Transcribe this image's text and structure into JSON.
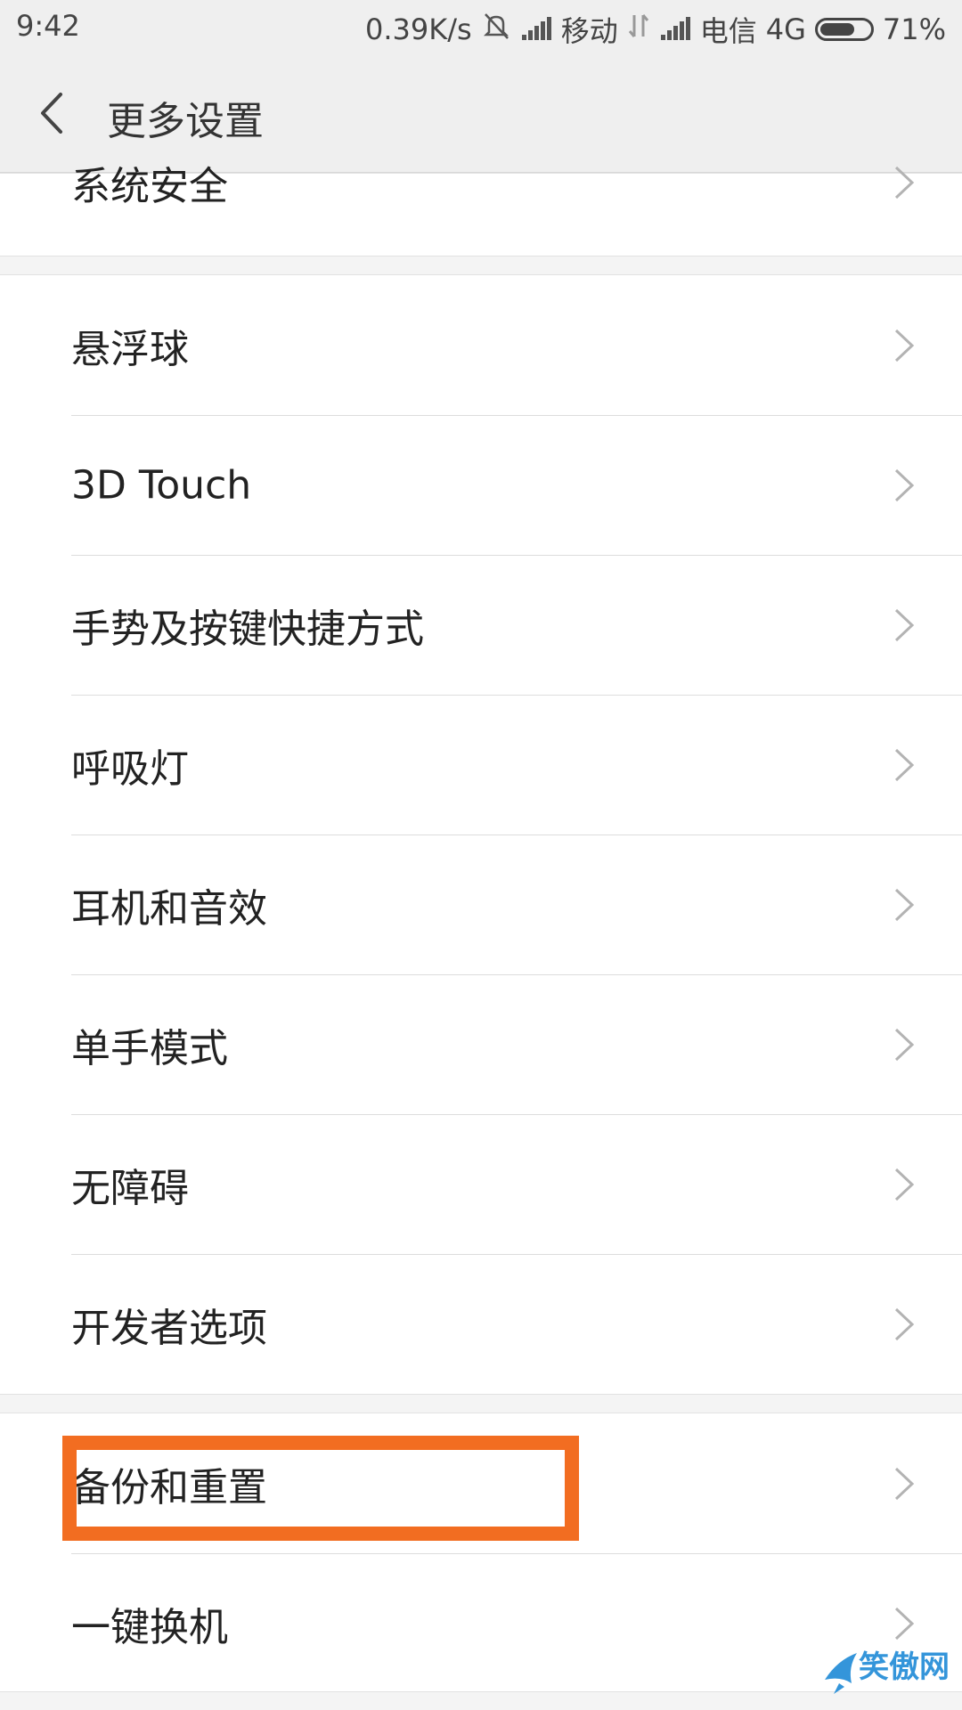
{
  "status_bar": {
    "time": "9:42",
    "speed": "0.39K/s",
    "carrier1": "移动",
    "carrier2": "电信",
    "network": "4G",
    "battery_percent": "71%",
    "battery_level": 0.71
  },
  "header": {
    "title": "更多设置"
  },
  "lists": {
    "group0": [
      {
        "label": "系统安全"
      }
    ],
    "group1": [
      {
        "label": "悬浮球"
      },
      {
        "label": "3D Touch"
      },
      {
        "label": "手势及按键快捷方式"
      },
      {
        "label": "呼吸灯"
      },
      {
        "label": "耳机和音效"
      },
      {
        "label": "单手模式"
      },
      {
        "label": "无障碍"
      },
      {
        "label": "开发者选项"
      }
    ],
    "group2": [
      {
        "label": "备份和重置"
      },
      {
        "label": "一键换机"
      }
    ]
  },
  "highlight_color": "#f26d21",
  "watermark": {
    "text": "笑傲网"
  }
}
